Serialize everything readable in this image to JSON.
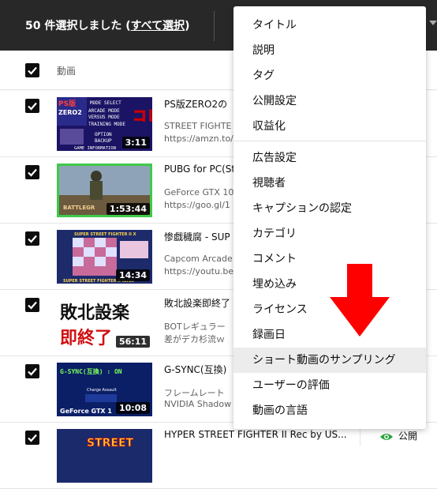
{
  "topbar": {
    "selected_text": "50 件選択しました",
    "select_all": "すべて選択"
  },
  "header": {
    "column_video": "動画"
  },
  "rows": [
    {
      "title": "PS版ZERO2の",
      "desc1": "STREET FIGHTE",
      "desc2": "https://amzn.to/",
      "duration": "3:11",
      "thumb_text": [
        "PS版",
        "ZERO2",
        "MODE SELECT",
        "ARCADE MODE",
        "VERSUS MODE",
        "TRAINING MODE",
        "OPTION",
        "BACKUP",
        "GAME INFORMATION",
        "コレ"
      ]
    },
    {
      "title": "PUBG for PC(St",
      "desc1": "GeForce GTX 10",
      "desc2": "https://goo.gl/1",
      "duration": "1:53:44",
      "thumb_text": [
        "BATTLEGR"
      ]
    },
    {
      "title": "惨戯穢腐 - SUP",
      "desc1": "Capcom Arcade",
      "desc2": "https://youtu.be",
      "duration": "14:34",
      "thumb_text": [
        "SUPER STREET FIGHTER II X",
        "SUPER STREET FIGHTER II turbo"
      ]
    },
    {
      "title": "敗北設楽即終了",
      "desc1": "BOTレギュラー",
      "desc2": "差がデカ杉流ｗ",
      "duration": "56:11",
      "thumb_text": [
        "敗北設楽",
        "即終了"
      ]
    },
    {
      "title": "G-SYNC(互換)",
      "desc1": "フレームレート",
      "desc2": "NVIDIA Shadow",
      "duration": "10:08",
      "thumb_text": [
        "G-SYNC(互換) : ON",
        "GeForce GTX 1",
        "Charge Assault"
      ]
    },
    {
      "title": "HYPER STREET FIGHTER II Rec by US...",
      "desc1": "",
      "desc2": "",
      "duration": "",
      "visibility": "公開",
      "thumb_text": [
        "STREET"
      ]
    }
  ],
  "menu": {
    "items": [
      "タイトル",
      "説明",
      "タグ",
      "公開設定",
      "収益化",
      "広告設定",
      "視聴者",
      "キャプションの認定",
      "カテゴリ",
      "コメント",
      "埋め込み",
      "ライセンス",
      "録画日",
      "ショート動画のサンプリング",
      "ユーザーの評価",
      "動画の言語"
    ],
    "highlighted_index": 13
  },
  "colors": {
    "topbar": "#282828",
    "arrow": "#ff0000",
    "visibility_icon": "#2ba640"
  }
}
